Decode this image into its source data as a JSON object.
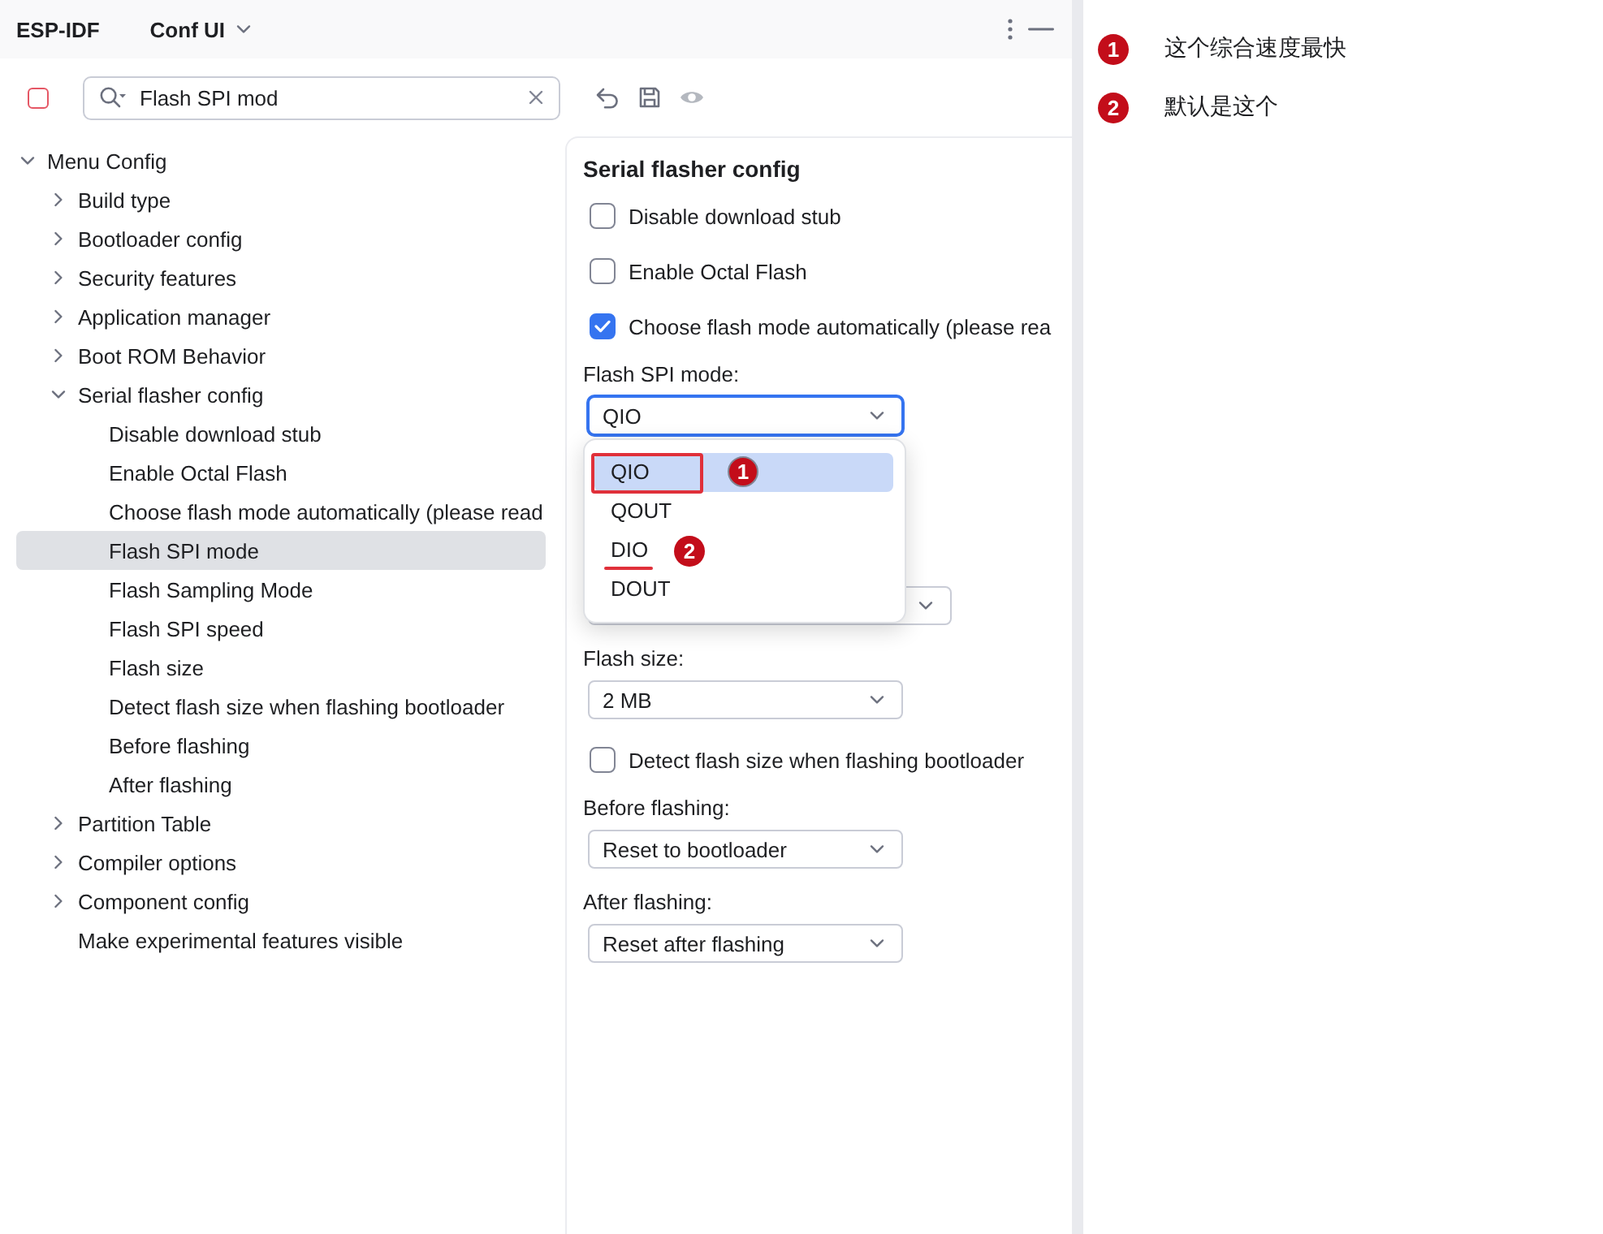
{
  "header": {
    "title": "ESP-IDF",
    "view": "Conf UI"
  },
  "filter_checkbox": {
    "checked": false
  },
  "search": {
    "value": "Flash SPI mod"
  },
  "toolbar": [
    {
      "kind": "undo",
      "disabled": false
    },
    {
      "kind": "save",
      "disabled": false
    },
    {
      "kind": "preview",
      "disabled": true
    }
  ],
  "tree": [
    {
      "label": "Menu Config",
      "kind": "menu",
      "expanded": true,
      "selected": false,
      "children": [
        {
          "label": "Build type",
          "kind": "menu",
          "expanded": false,
          "selected": false
        },
        {
          "label": "Bootloader config",
          "kind": "menu",
          "expanded": false,
          "selected": false
        },
        {
          "label": "Security features",
          "kind": "menu",
          "expanded": false,
          "selected": false
        },
        {
          "label": "Application manager",
          "kind": "menu",
          "expanded": false,
          "selected": false
        },
        {
          "label": "Boot ROM Behavior",
          "kind": "menu",
          "expanded": false,
          "selected": false
        },
        {
          "label": "Serial flasher config",
          "kind": "menu",
          "expanded": true,
          "selected": false,
          "children": [
            {
              "label": "Disable download stub",
              "kind": "option",
              "selected": false
            },
            {
              "label": "Enable Octal Flash",
              "kind": "option",
              "selected": false
            },
            {
              "label": "Choose flash mode automatically (please read",
              "kind": "option",
              "selected": false
            },
            {
              "label": "Flash SPI mode",
              "kind": "option",
              "selected": true
            },
            {
              "label": "Flash Sampling Mode",
              "kind": "option",
              "selected": false
            },
            {
              "label": "Flash SPI speed",
              "kind": "option",
              "selected": false
            },
            {
              "label": "Flash size",
              "kind": "option",
              "selected": false
            },
            {
              "label": "Detect flash size when flashing bootloader",
              "kind": "option",
              "selected": false
            },
            {
              "label": "Before flashing",
              "kind": "option",
              "selected": false
            },
            {
              "label": "After flashing",
              "kind": "option",
              "selected": false
            }
          ]
        },
        {
          "label": "Partition Table",
          "kind": "menu",
          "expanded": false,
          "selected": false
        },
        {
          "label": "Compiler options",
          "kind": "menu",
          "expanded": false,
          "selected": false
        },
        {
          "label": "Component config",
          "kind": "menu",
          "expanded": false,
          "selected": false
        },
        {
          "label": "Make experimental features visible",
          "kind": "option",
          "selected": false
        }
      ]
    }
  ],
  "settings": {
    "title": "Serial flasher config",
    "fields": [
      {
        "kind": "checkbox",
        "label": "Disable download stub",
        "checked": false
      },
      {
        "kind": "checkbox",
        "label": "Enable Octal Flash",
        "checked": false
      },
      {
        "kind": "checkbox",
        "label": "Choose flash mode automatically (please rea",
        "checked": true
      },
      {
        "kind": "select",
        "label": "Flash SPI mode:",
        "value": "QIO",
        "focused": true,
        "expanded": true,
        "options": [
          {
            "label": "QIO",
            "selected": true,
            "annotation": {
              "kind": "box",
              "badge": "1"
            }
          },
          {
            "label": "QOUT",
            "selected": false
          },
          {
            "label": "DIO",
            "selected": false,
            "annotation": {
              "kind": "underline",
              "badge": "2"
            }
          },
          {
            "label": "DOUT",
            "selected": false
          }
        ]
      },
      {
        "kind": "select",
        "focused": false
      },
      {
        "kind": "select",
        "label": "Flash size:",
        "value": "2 MB",
        "focused": false
      },
      {
        "kind": "checkbox",
        "label": "Detect flash size when flashing bootloader",
        "checked": false
      },
      {
        "kind": "select",
        "label": "Before flashing:",
        "value": "Reset to bootloader",
        "focused": false
      },
      {
        "kind": "select",
        "label": "After flashing:",
        "value": "Reset after flashing",
        "focused": false
      }
    ]
  },
  "notes": [
    {
      "badge": "1",
      "text": "这个综合速度最快"
    },
    {
      "badge": "2",
      "text": "默认是这个"
    }
  ]
}
